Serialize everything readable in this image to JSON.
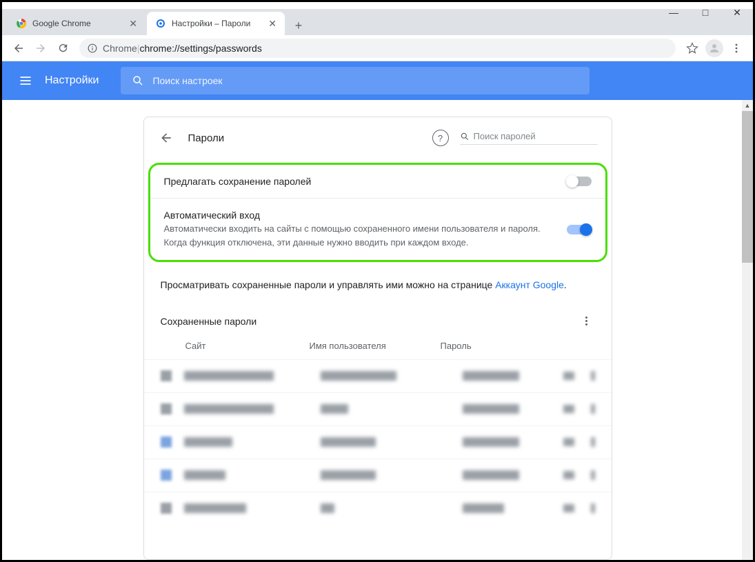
{
  "window": {
    "minimize": "—",
    "maximize": "□",
    "close": "✕"
  },
  "tabs": [
    {
      "title": "Google Chrome"
    },
    {
      "title": "Настройки – Пароли"
    }
  ],
  "omnibox": {
    "origin": "Chrome",
    "sep": " | ",
    "path": "chrome://settings/passwords"
  },
  "settings_header": {
    "title": "Настройки",
    "search_placeholder": "Поиск настроек"
  },
  "page": {
    "title": "Пароли",
    "pw_search_placeholder": "Поиск паролей",
    "help": "?"
  },
  "toggles": {
    "offer_save": {
      "label": "Предлагать сохранение паролей",
      "on": false
    },
    "auto_signin": {
      "label": "Автоматический вход",
      "desc": "Автоматически входить на сайты с помощью сохраненного имени пользователя и пароля. Когда функция отключена, эти данные нужно вводить при каждом входе.",
      "on": true
    }
  },
  "info": {
    "text_prefix": "Просматривать сохраненные пароли и управлять ими можно на странице ",
    "link": "Аккаунт Google",
    "suffix": "."
  },
  "saved": {
    "section_title": "Сохраненные пароли",
    "columns": {
      "site": "Сайт",
      "user": "Имя пользователя",
      "pass": "Пароль"
    }
  }
}
